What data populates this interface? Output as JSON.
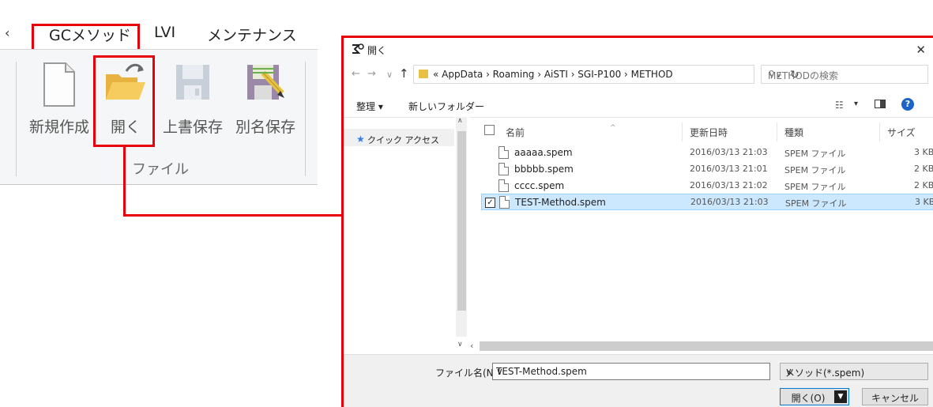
{
  "ribbon": {
    "tabs": [
      "GCメソッド",
      "LVI",
      "メンテナンス"
    ],
    "buttons": {
      "new": "新規作成",
      "open": "開く",
      "save": "上書保存",
      "save_as": "別名保存"
    },
    "group_label": "ファイル"
  },
  "dialog": {
    "title": "開く",
    "breadcrumb": "« AppData › Roaming › AiSTI › SGI-P100 › METHOD",
    "search_placeholder": "METHODの検索",
    "organize_label": "整理 ▾",
    "new_folder_label": "新しいフォルダー",
    "nav_pane": {
      "quick_access": "クイック アクセス"
    },
    "columns": {
      "name": "名前",
      "date": "更新日時",
      "type": "種類",
      "size": "サイズ"
    },
    "files": [
      {
        "name": "aaaaa.spem",
        "date": "2016/03/13 21:03",
        "type": "SPEM ファイル",
        "size": "3 KB",
        "selected": false
      },
      {
        "name": "bbbbb.spem",
        "date": "2016/03/13 21:01",
        "type": "SPEM ファイル",
        "size": "2 KB",
        "selected": false
      },
      {
        "name": "cccc.spem",
        "date": "2016/03/13 21:02",
        "type": "SPEM ファイル",
        "size": "2 KB",
        "selected": false
      },
      {
        "name": "TEST-Method.spem",
        "date": "2016/03/13 21:03",
        "type": "SPEM ファイル",
        "size": "3 KB",
        "selected": true
      }
    ],
    "filename_label": "ファイル名(N):",
    "filename_value": "TEST-Method.spem",
    "filetype_value": "メソッド(*.spem)",
    "open_button": "開く(O)",
    "cancel_button": "キャンセル"
  },
  "colors": {
    "highlight": "#e8000b",
    "selection": "#cce8ff",
    "accent": "#0078d7"
  }
}
